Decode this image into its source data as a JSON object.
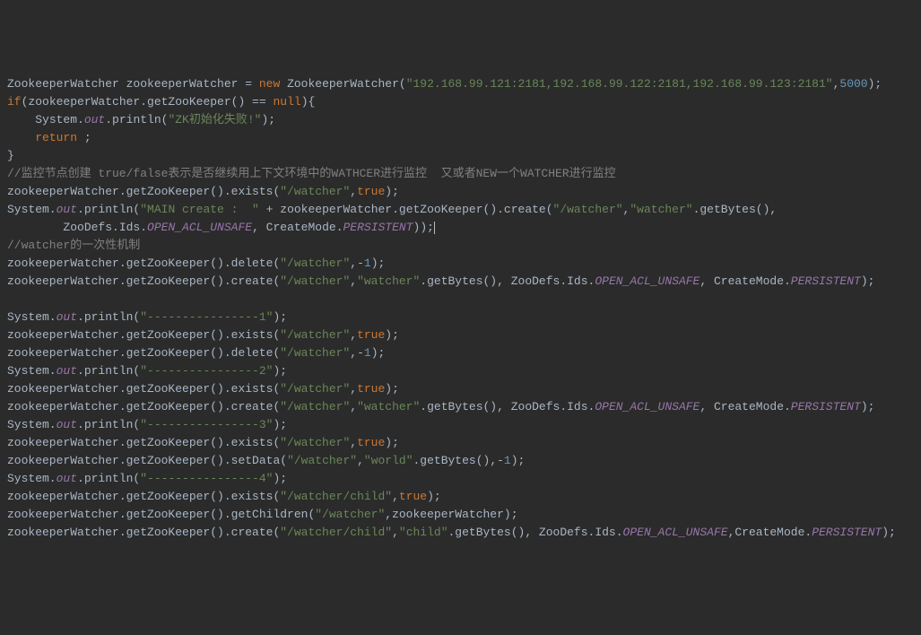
{
  "code": {
    "lines": [
      {
        "indent": 0,
        "tokens": [
          {
            "t": "ZookeeperWatcher zookeeperWatcher = ",
            "c": "c-default"
          },
          {
            "t": "new ",
            "c": "c-keyword"
          },
          {
            "t": "ZookeeperWatcher(",
            "c": "c-default"
          },
          {
            "t": "\"192.168.99.121:2181,192.168.99.122:2181,192.168.99.123:2181\"",
            "c": "c-string"
          },
          {
            "t": ",",
            "c": "c-default"
          },
          {
            "t": "5000",
            "c": "c-number"
          },
          {
            "t": ");",
            "c": "c-default"
          }
        ]
      },
      {
        "indent": 0,
        "tokens": [
          {
            "t": "if",
            "c": "c-keyword"
          },
          {
            "t": "(zookeeperWatcher.getZooKeeper() == ",
            "c": "c-default"
          },
          {
            "t": "null",
            "c": "c-keyword"
          },
          {
            "t": "){",
            "c": "c-default"
          }
        ]
      },
      {
        "indent": 1,
        "tokens": [
          {
            "t": "System.",
            "c": "c-default"
          },
          {
            "t": "out",
            "c": "c-static"
          },
          {
            "t": ".println(",
            "c": "c-default"
          },
          {
            "t": "\"ZK初始化失败!\"",
            "c": "c-string"
          },
          {
            "t": ");",
            "c": "c-default"
          }
        ]
      },
      {
        "indent": 1,
        "tokens": [
          {
            "t": "return ",
            "c": "c-keyword"
          },
          {
            "t": ";",
            "c": "c-default"
          }
        ]
      },
      {
        "indent": 0,
        "tokens": [
          {
            "t": "}",
            "c": "c-default"
          }
        ]
      },
      {
        "indent": 0,
        "tokens": [
          {
            "t": "//监控节点创建 true/false表示是否继续用上下文环境中的WATHCER进行监控  又或者NEW一个WATCHER进行监控",
            "c": "c-comment"
          }
        ]
      },
      {
        "indent": 0,
        "tokens": [
          {
            "t": "zookeeperWatcher.getZooKeeper().exists(",
            "c": "c-default"
          },
          {
            "t": "\"/watcher\"",
            "c": "c-string"
          },
          {
            "t": ",",
            "c": "c-default"
          },
          {
            "t": "true",
            "c": "c-keyword"
          },
          {
            "t": ");",
            "c": "c-default"
          }
        ]
      },
      {
        "indent": 0,
        "tokens": [
          {
            "t": "System.",
            "c": "c-default"
          },
          {
            "t": "out",
            "c": "c-static"
          },
          {
            "t": ".println(",
            "c": "c-default"
          },
          {
            "t": "\"MAIN create :  \" ",
            "c": "c-string"
          },
          {
            "t": "+ zookeeperWatcher.getZooKeeper().create(",
            "c": "c-default"
          },
          {
            "t": "\"/watcher\"",
            "c": "c-string"
          },
          {
            "t": ",",
            "c": "c-default"
          },
          {
            "t": "\"watcher\"",
            "c": "c-string"
          },
          {
            "t": ".getBytes(),",
            "c": "c-default"
          }
        ]
      },
      {
        "indent": 2,
        "tokens": [
          {
            "t": "ZooDefs.Ids.",
            "c": "c-default"
          },
          {
            "t": "OPEN_ACL_UNSAFE",
            "c": "c-constant"
          },
          {
            "t": ", CreateMode.",
            "c": "c-default"
          },
          {
            "t": "PERSISTENT",
            "c": "c-constant"
          },
          {
            "t": "));",
            "c": "c-default"
          },
          {
            "t": "",
            "c": "cursor"
          }
        ]
      },
      {
        "indent": 0,
        "tokens": [
          {
            "t": "//watcher的一次性机制",
            "c": "c-comment"
          }
        ]
      },
      {
        "indent": 0,
        "tokens": [
          {
            "t": "zookeeperWatcher.getZooKeeper().delete(",
            "c": "c-default"
          },
          {
            "t": "\"/watcher\"",
            "c": "c-string"
          },
          {
            "t": ",-",
            "c": "c-default"
          },
          {
            "t": "1",
            "c": "c-number"
          },
          {
            "t": ");",
            "c": "c-default"
          }
        ]
      },
      {
        "indent": 0,
        "tokens": [
          {
            "t": "zookeeperWatcher.getZooKeeper().create(",
            "c": "c-default"
          },
          {
            "t": "\"/watcher\"",
            "c": "c-string"
          },
          {
            "t": ",",
            "c": "c-default"
          },
          {
            "t": "\"watcher\"",
            "c": "c-string"
          },
          {
            "t": ".getBytes(), ZooDefs.Ids.",
            "c": "c-default"
          },
          {
            "t": "OPEN_ACL_UNSAFE",
            "c": "c-constant"
          },
          {
            "t": ", CreateMode.",
            "c": "c-default"
          },
          {
            "t": "PERSISTENT",
            "c": "c-constant"
          },
          {
            "t": ");",
            "c": "c-default"
          }
        ]
      },
      {
        "indent": 0,
        "tokens": []
      },
      {
        "indent": 0,
        "tokens": [
          {
            "t": "System.",
            "c": "c-default"
          },
          {
            "t": "out",
            "c": "c-static"
          },
          {
            "t": ".println(",
            "c": "c-default"
          },
          {
            "t": "\"----------------1\"",
            "c": "c-string"
          },
          {
            "t": ");",
            "c": "c-default"
          }
        ]
      },
      {
        "indent": 0,
        "tokens": [
          {
            "t": "zookeeperWatcher.getZooKeeper().exists(",
            "c": "c-default"
          },
          {
            "t": "\"/watcher\"",
            "c": "c-string"
          },
          {
            "t": ",",
            "c": "c-default"
          },
          {
            "t": "true",
            "c": "c-keyword"
          },
          {
            "t": ");",
            "c": "c-default"
          }
        ]
      },
      {
        "indent": 0,
        "tokens": [
          {
            "t": "zookeeperWatcher.getZooKeeper().delete(",
            "c": "c-default"
          },
          {
            "t": "\"/watcher\"",
            "c": "c-string"
          },
          {
            "t": ",-",
            "c": "c-default"
          },
          {
            "t": "1",
            "c": "c-number"
          },
          {
            "t": ");",
            "c": "c-default"
          }
        ]
      },
      {
        "indent": 0,
        "tokens": [
          {
            "t": "System.",
            "c": "c-default"
          },
          {
            "t": "out",
            "c": "c-static"
          },
          {
            "t": ".println(",
            "c": "c-default"
          },
          {
            "t": "\"----------------2\"",
            "c": "c-string"
          },
          {
            "t": ");",
            "c": "c-default"
          }
        ]
      },
      {
        "indent": 0,
        "tokens": [
          {
            "t": "zookeeperWatcher.getZooKeeper().exists(",
            "c": "c-default"
          },
          {
            "t": "\"/watcher\"",
            "c": "c-string"
          },
          {
            "t": ",",
            "c": "c-default"
          },
          {
            "t": "true",
            "c": "c-keyword"
          },
          {
            "t": ");",
            "c": "c-default"
          }
        ]
      },
      {
        "indent": 0,
        "tokens": [
          {
            "t": "zookeeperWatcher.getZooKeeper().create(",
            "c": "c-default"
          },
          {
            "t": "\"/watcher\"",
            "c": "c-string"
          },
          {
            "t": ",",
            "c": "c-default"
          },
          {
            "t": "\"watcher\"",
            "c": "c-string"
          },
          {
            "t": ".getBytes(), ZooDefs.Ids.",
            "c": "c-default"
          },
          {
            "t": "OPEN_ACL_UNSAFE",
            "c": "c-constant"
          },
          {
            "t": ", CreateMode.",
            "c": "c-default"
          },
          {
            "t": "PERSISTENT",
            "c": "c-constant"
          },
          {
            "t": ");",
            "c": "c-default"
          }
        ]
      },
      {
        "indent": 0,
        "tokens": [
          {
            "t": "System.",
            "c": "c-default"
          },
          {
            "t": "out",
            "c": "c-static"
          },
          {
            "t": ".println(",
            "c": "c-default"
          },
          {
            "t": "\"----------------3\"",
            "c": "c-string"
          },
          {
            "t": ");",
            "c": "c-default"
          }
        ]
      },
      {
        "indent": 0,
        "tokens": [
          {
            "t": "zookeeperWatcher.getZooKeeper().exists(",
            "c": "c-default"
          },
          {
            "t": "\"/watcher\"",
            "c": "c-string"
          },
          {
            "t": ",",
            "c": "c-default"
          },
          {
            "t": "true",
            "c": "c-keyword"
          },
          {
            "t": ");",
            "c": "c-default"
          }
        ]
      },
      {
        "indent": 0,
        "tokens": [
          {
            "t": "zookeeperWatcher.getZooKeeper().setData(",
            "c": "c-default"
          },
          {
            "t": "\"/watcher\"",
            "c": "c-string"
          },
          {
            "t": ",",
            "c": "c-default"
          },
          {
            "t": "\"world\"",
            "c": "c-string"
          },
          {
            "t": ".getBytes(),-",
            "c": "c-default"
          },
          {
            "t": "1",
            "c": "c-number"
          },
          {
            "t": ");",
            "c": "c-default"
          }
        ]
      },
      {
        "indent": 0,
        "tokens": [
          {
            "t": "System.",
            "c": "c-default"
          },
          {
            "t": "out",
            "c": "c-static"
          },
          {
            "t": ".println(",
            "c": "c-default"
          },
          {
            "t": "\"----------------4\"",
            "c": "c-string"
          },
          {
            "t": ");",
            "c": "c-default"
          }
        ]
      },
      {
        "indent": 0,
        "tokens": [
          {
            "t": "zookeeperWatcher.getZooKeeper().exists(",
            "c": "c-default"
          },
          {
            "t": "\"/watcher/child\"",
            "c": "c-string"
          },
          {
            "t": ",",
            "c": "c-default"
          },
          {
            "t": "true",
            "c": "c-keyword"
          },
          {
            "t": ");",
            "c": "c-default"
          }
        ]
      },
      {
        "indent": 0,
        "tokens": [
          {
            "t": "zookeeperWatcher.getZooKeeper().getChildren(",
            "c": "c-default"
          },
          {
            "t": "\"/watcher\"",
            "c": "c-string"
          },
          {
            "t": ",zookeeperWatcher);",
            "c": "c-default"
          }
        ]
      },
      {
        "indent": 0,
        "tokens": [
          {
            "t": "zookeeperWatcher.getZooKeeper().create(",
            "c": "c-default"
          },
          {
            "t": "\"/watcher/child\"",
            "c": "c-string"
          },
          {
            "t": ",",
            "c": "c-default"
          },
          {
            "t": "\"child\"",
            "c": "c-string"
          },
          {
            "t": ".getBytes(), ZooDefs.Ids.",
            "c": "c-default"
          },
          {
            "t": "OPEN_ACL_UNSAFE",
            "c": "c-constant"
          },
          {
            "t": ",CreateMode.",
            "c": "c-default"
          },
          {
            "t": "PERSISTENT",
            "c": "c-constant"
          },
          {
            "t": ");",
            "c": "c-default"
          }
        ]
      }
    ]
  }
}
